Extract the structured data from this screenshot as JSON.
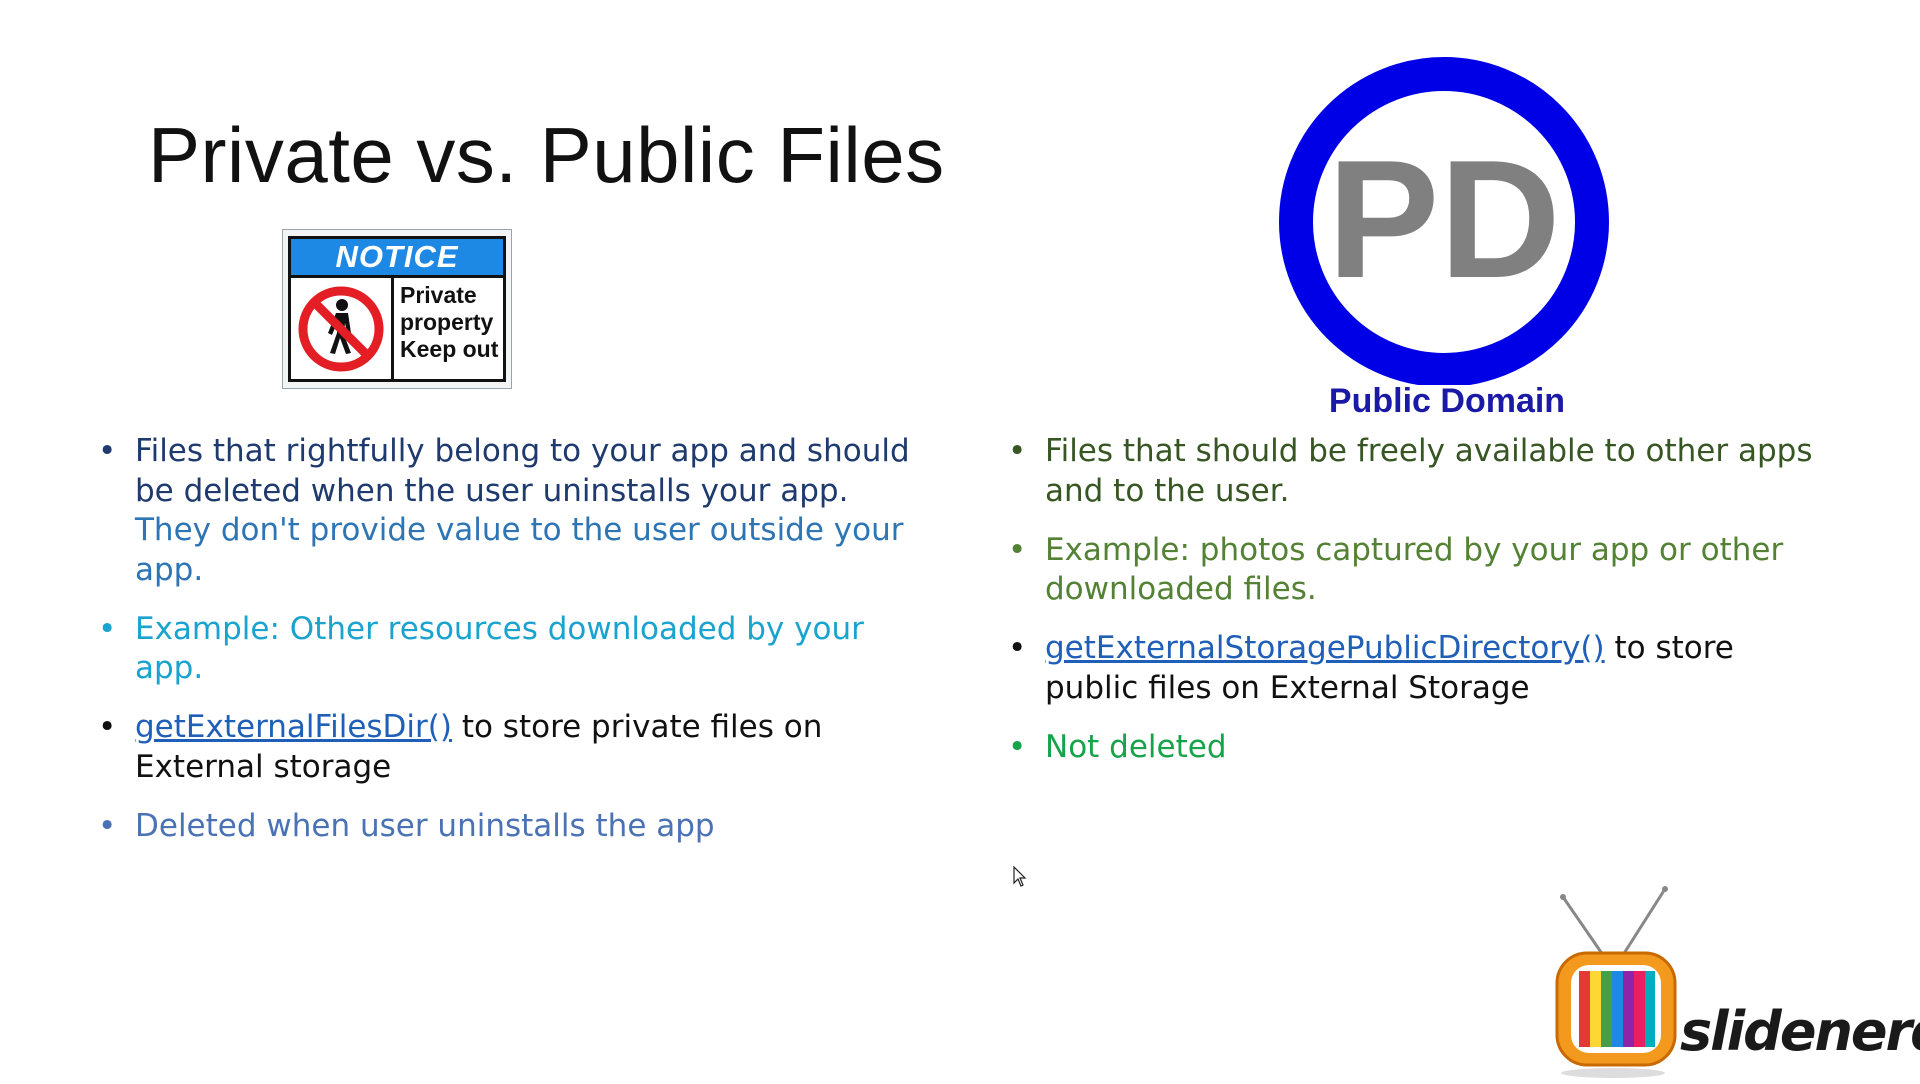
{
  "slide": {
    "title": "Private vs. Public Files"
  },
  "notice_sign": {
    "header": "NOTICE",
    "lines": [
      "Private",
      "property",
      "Keep out"
    ],
    "header_color": "#1e88e5"
  },
  "public_domain_logo": {
    "letters": "PD",
    "caption": "Public Domain",
    "ring_color": "#0000e6",
    "letter_color": "#808080"
  },
  "left_bullets": [
    {
      "text": "Files that rightfully belong to your app and should be deleted when the user uninstalls your app. ",
      "text_b": "They don't provide value to the user outside your app.",
      "color": "#1f3a6e",
      "color_b": "#2e75b6"
    },
    {
      "text": "Example: Other resources downloaded by your app.",
      "color": "#1aa3cf"
    },
    {
      "link": "getExternalFilesDir()",
      "text": " to store private files on External storage",
      "color": "#111111"
    },
    {
      "text": "Deleted when user uninstalls the app",
      "color": "#4a72b5"
    }
  ],
  "right_bullets": [
    {
      "text": "Files that should be freely available to other apps and to the user.",
      "color": "#375623"
    },
    {
      "text": "Example: photos captured by your app or other downloaded files.",
      "color": "#548235"
    },
    {
      "link": "getExternalStoragePublicDirectory()",
      "text": " to store public files on External Storage",
      "color": "#111111"
    },
    {
      "text": "Not deleted",
      "color": "#17a34a"
    }
  ],
  "brand": {
    "name": "slidenerd",
    "icon": "retro-tv-icon"
  }
}
